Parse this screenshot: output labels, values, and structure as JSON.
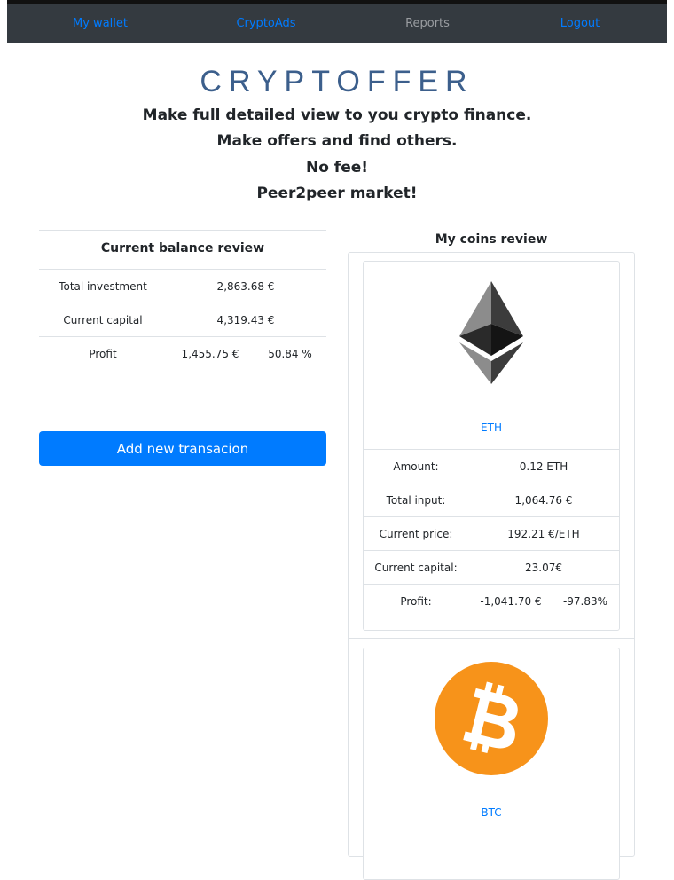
{
  "nav": {
    "my_wallet": "My wallet",
    "crypto_ads": "CryptoAds",
    "reports": "Reports",
    "logout": "Logout"
  },
  "header": {
    "brand": "CRYPTOFFER",
    "taglines": [
      "Make full detailed view to you crypto finance.",
      "Make offers and find others.",
      "No fee!",
      "Peer2peer market!"
    ]
  },
  "balance": {
    "title": "Current balance review",
    "total_investment_label": "Total investment",
    "total_investment_value": "2,863.68 €",
    "current_capital_label": "Current capital",
    "current_capital_value": "4,319.43 €",
    "profit_label": "Profit",
    "profit_value": "1,455.75 €",
    "profit_percent": "50.84 %"
  },
  "add_button_label": "Add new transacion",
  "coins": {
    "title": "My coins review",
    "items": [
      {
        "name": "ETH",
        "icon": "ethereum-icon",
        "amount_label": "Amount:",
        "amount": "0.12 ETH",
        "total_input_label": "Total input:",
        "total_input": "1,064.76 €",
        "current_price_label": "Current price:",
        "current_price": "192.21 €/ETH",
        "current_capital_label": "Current capital:",
        "current_capital": "23.07€",
        "profit_label": "Profit:",
        "profit": "-1,041.70 €",
        "profit_percent": "-97.83%"
      },
      {
        "name": "BTC",
        "icon": "bitcoin-icon",
        "color": "#f7931a"
      }
    ]
  },
  "colors": {
    "navbar_bg": "#343a40",
    "link": "#007bff",
    "brand": "#3c5f8c",
    "btc_orange": "#f7931a"
  }
}
